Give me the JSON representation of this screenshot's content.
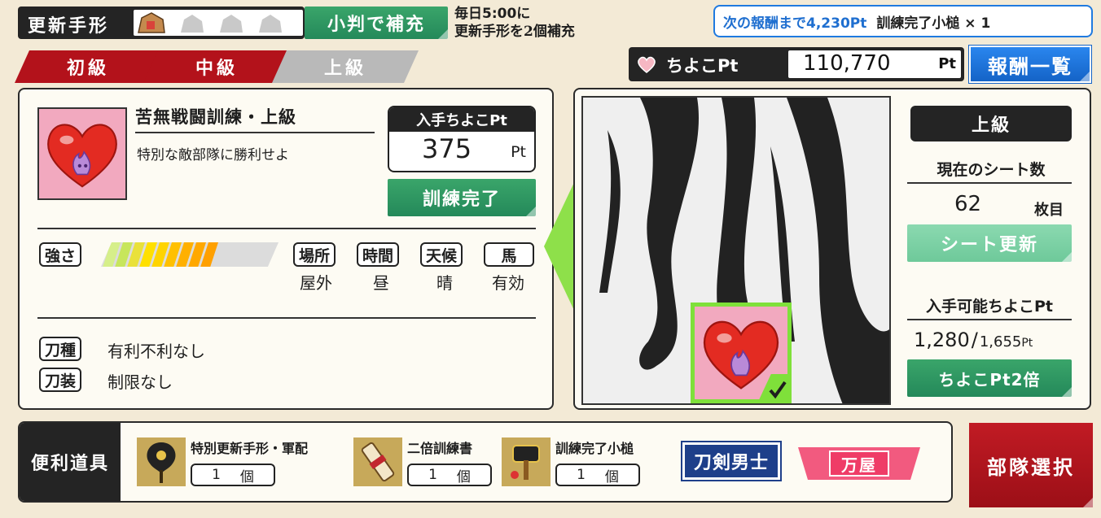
{
  "top": {
    "pass_label": "更新手形",
    "refill_button": "小判で補充",
    "refill_note_line1": "毎日5:00に",
    "refill_note_line2": "更新手形を2個補充",
    "reward_notice": "次の報酬まで4,230Pt",
    "reward_item": "訓練完了小槌 × 1",
    "choko_label": "ちよこPt",
    "choko_value": "110,770",
    "choko_unit": "Pt",
    "reward_list_button": "報酬一覧"
  },
  "tabs": [
    {
      "label": "初級",
      "state": "inactive"
    },
    {
      "label": "中級",
      "state": "inactive"
    },
    {
      "label": "上級",
      "state": "selected"
    }
  ],
  "mission": {
    "title": "苦無戦闘訓練・上級",
    "desc": "特別な敵部隊に勝利せよ",
    "points_header": "入手ちよこPt",
    "points_value": "375",
    "points_unit": "Pt",
    "complete_button": "訓練完了",
    "strength_label": "強さ",
    "strength_level": 0.6,
    "conditions": [
      {
        "label": "場所",
        "value": "屋外"
      },
      {
        "label": "時間",
        "value": "昼"
      },
      {
        "label": "天候",
        "value": "晴"
      },
      {
        "label": "馬",
        "value": "有効"
      }
    ],
    "sword_type_label": "刀種",
    "sword_type_value": "有利不利なし",
    "equipment_label": "刀装",
    "equipment_value": "制限なし"
  },
  "sheet": {
    "level_badge": "上級",
    "current_sheet_label": "現在のシート数",
    "current_sheet_value": "62",
    "current_sheet_unit": "枚目",
    "refresh_button": "シート更新",
    "obtainable_label": "入手可能ちよこPt",
    "obtainable_value": "1,280",
    "obtainable_sep": "/",
    "obtainable_total": "1,655",
    "obtainable_unit": "Pt",
    "double_button": "ちよこPt2倍"
  },
  "tools": {
    "label": "便利道具",
    "items": [
      {
        "name": "特別更新手形・軍配",
        "count": "1",
        "unit": "個"
      },
      {
        "name": "二倍訓練書",
        "count": "1",
        "unit": "個"
      },
      {
        "name": "訓練完了小槌",
        "count": "1",
        "unit": "個"
      }
    ],
    "touken_button": "刀剣男士",
    "yorozuya_button": "万屋",
    "squad_button": "部隊選択"
  },
  "colors": {
    "accent_red": "#b3121b",
    "accent_green": "#2e9a62",
    "accent_blue": "#1f7ae0",
    "dark": "#242424"
  }
}
